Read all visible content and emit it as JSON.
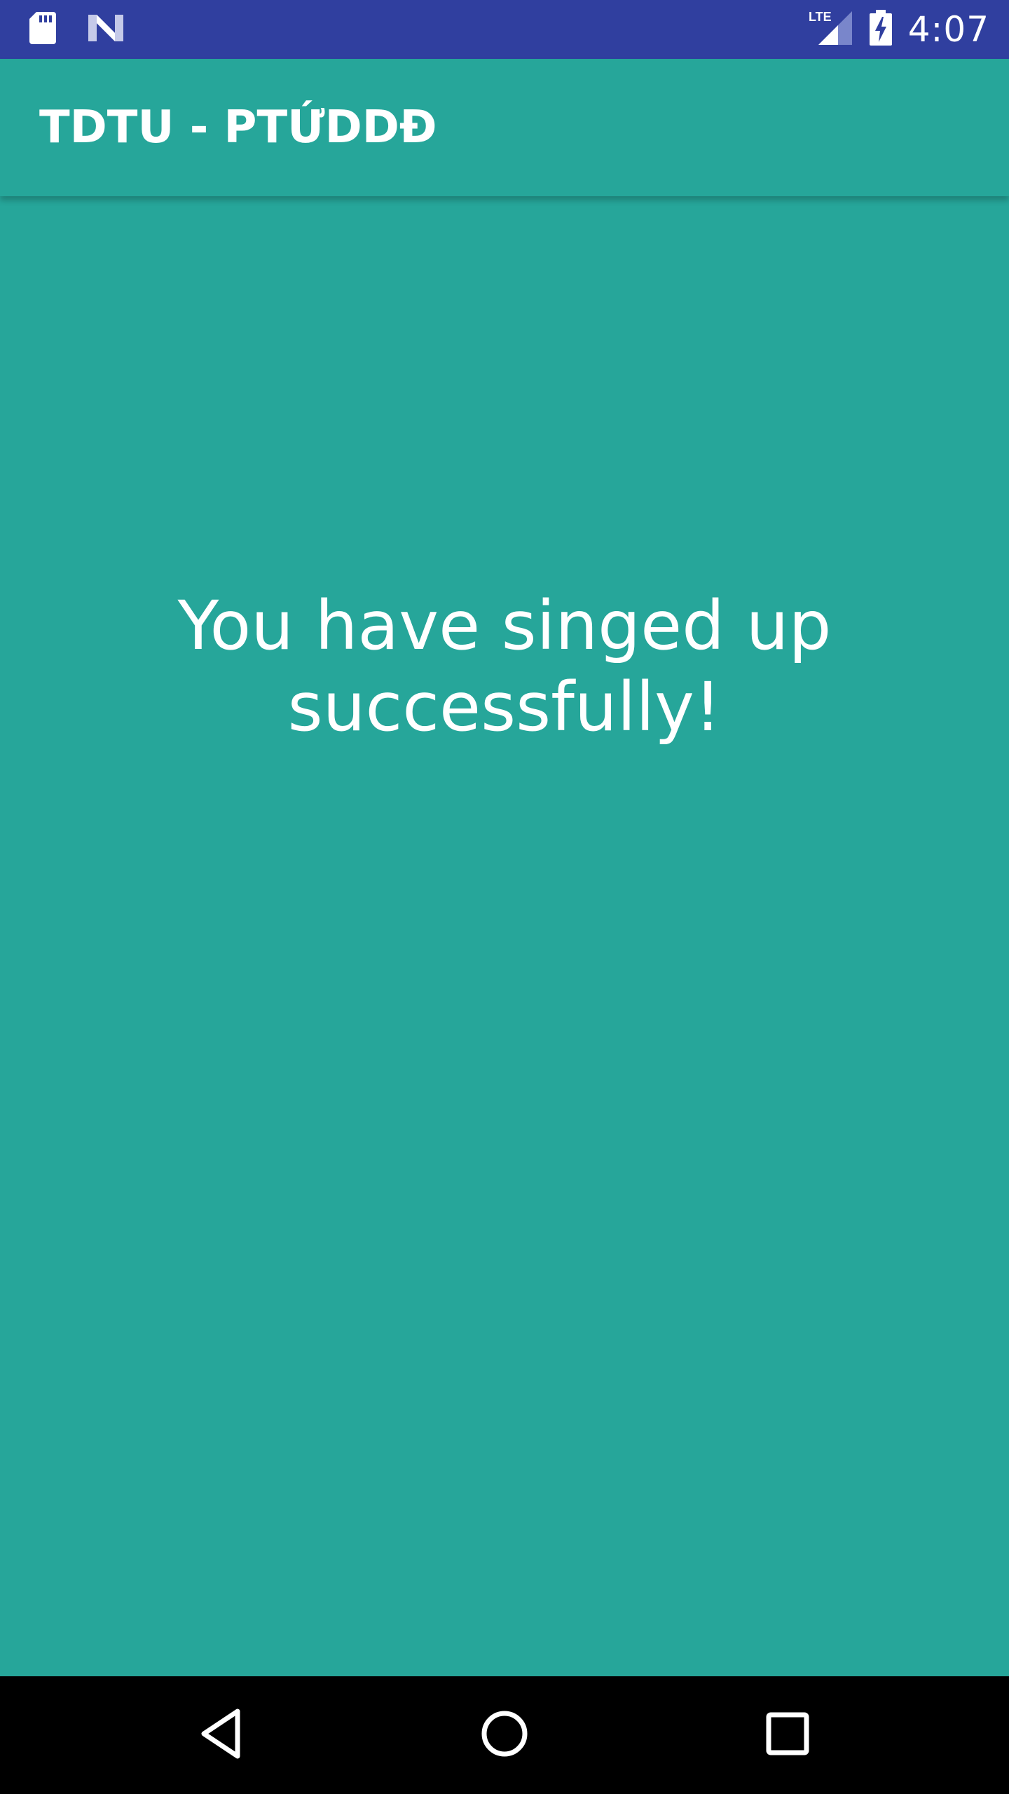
{
  "status_bar": {
    "time": "4:07",
    "network": "LTE",
    "icons": [
      "sd-card-icon",
      "n-logo-icon",
      "signal-icon",
      "battery-charging-icon"
    ],
    "color": "#303F9F"
  },
  "app_bar": {
    "title": "TDTU - PTỨDDĐ",
    "color": "#26A69A"
  },
  "main": {
    "message": "You have singed up successfully!",
    "background": "#26A69A"
  },
  "nav_bar": {
    "buttons": [
      "back-icon",
      "home-icon",
      "recents-icon"
    ]
  }
}
